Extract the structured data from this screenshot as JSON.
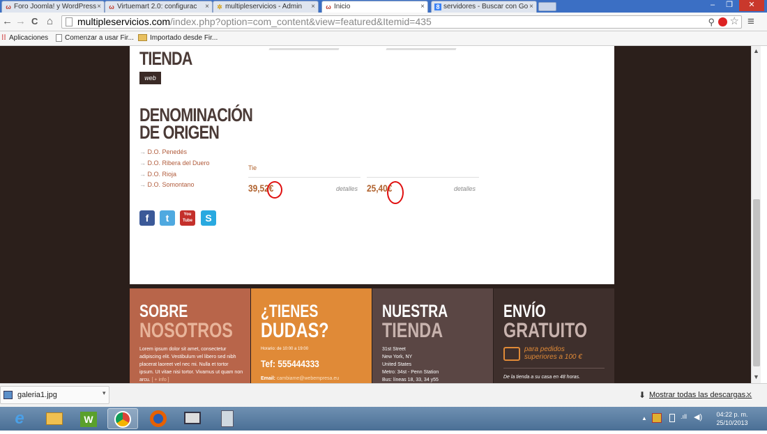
{
  "browser": {
    "tabs": [
      {
        "title": "Foro Joomla! y WordPress",
        "close": "×"
      },
      {
        "title": "Virtuemart 2.0: configurac",
        "close": "×"
      },
      {
        "title": "multipleservicios - Admin",
        "close": "×"
      },
      {
        "title": "Inicio",
        "close": "×"
      },
      {
        "title": "servidores - Buscar con Go",
        "close": "×"
      }
    ],
    "window_buttons": [
      "–",
      "❐",
      "✕"
    ],
    "url_domain": "multipleservicios.com",
    "url_path": "/index.php?option=com_content&view=featured&Itemid=435",
    "bookmarks": [
      "Aplicaciones",
      "Comenzar a usar Fir...",
      "Importado desde Fir..."
    ],
    "nav_back": "←",
    "nav_forward": "→",
    "nav_reload": "C",
    "nav_home": "⌂",
    "menu_glyph": "≡"
  },
  "page": {
    "tienda_title": "TIENDA",
    "badge": "web",
    "denominacion_title1": "DENOMINACIÓN",
    "denominacion_title2": "DE ORIGEN",
    "do_items": [
      "D.O. Penedés",
      "D.O. Ribera del Duero",
      "D.O. Rioja",
      "D.O. Somontano"
    ],
    "arrow": "→",
    "product_label": "Tie",
    "products": [
      {
        "price": "39,52€",
        "details": "detalles"
      },
      {
        "price": "25,40€",
        "details": "detalles"
      }
    ],
    "social": [
      "f",
      "t",
      "You Tube",
      "S"
    ]
  },
  "footer": {
    "cols": [
      {
        "t1": "SOBRE",
        "t2": "NOSOTROS",
        "text": "Lorem ipsum dolor sit amet, consectetur adipiscing elit. Vestibulum vel libero sed nibh placerat laoreet vel nec mi. Nulla et tortor ipsum. Ut vitae nisi tortor. Vivamus ut quam non arcu.",
        "more": "[ + info ]"
      },
      {
        "t1": "¿TIENES",
        "t2": "DUDAS?",
        "hours": "Horario: de 10:00 a 19:00",
        "tel": "Tef: 555444333",
        "email_label": "Email:",
        "email": "cambiame@webempresa.eu"
      },
      {
        "t1": "NUESTRA",
        "t2": "TIENDA",
        "lines": [
          "31st Street",
          "New York, NY",
          "United States",
          "Metro: 34st - Penn Station",
          "Bus: líneas 18, 33, 34 y55"
        ]
      },
      {
        "t1": "ENVÍO",
        "t2": "GRATUITO",
        "promo1": "para pedidos",
        "promo2": "superiores a 100 €",
        "tagline": "De la tienda a su casa en 48 horas."
      }
    ]
  },
  "downloads": {
    "file": "galeria1.jpg",
    "show_all": "Mostrar todas las descargas...",
    "close": "×"
  },
  "taskbar": {
    "time": "04:22 p. m.",
    "date": "25/10/2013"
  },
  "colors": {
    "sobre": "#b8654a",
    "dudas": "#e08a37",
    "nuestra": "#5a4644",
    "envio": "#3e2f2c",
    "accent": "#e08a37"
  }
}
